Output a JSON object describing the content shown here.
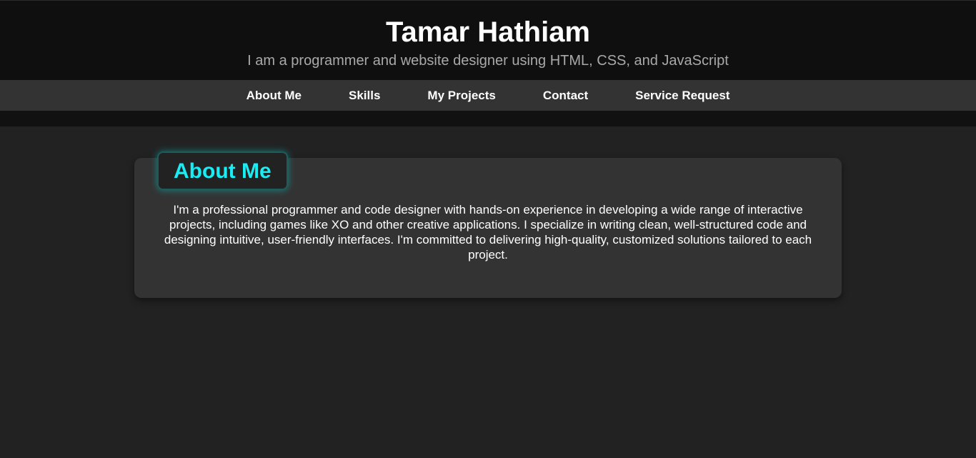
{
  "header": {
    "title": "Tamar Hathiam",
    "subtitle": "I am a programmer and website designer using HTML, CSS, and JavaScript"
  },
  "nav": {
    "items": [
      {
        "label": "About Me"
      },
      {
        "label": "Skills"
      },
      {
        "label": "My Projects"
      },
      {
        "label": "Contact"
      },
      {
        "label": "Service Request"
      }
    ]
  },
  "about": {
    "heading": "About Me",
    "text": "I'm a professional programmer and code designer with hands-on experience in developing a wide range of interactive projects, including games like XO and other creative applications. I specialize in writing clean, well-structured code and designing intuitive, user-friendly interfaces. I'm committed to delivering high-quality, customized solutions tailored to each project."
  },
  "colors": {
    "background": "#222222",
    "header_bg": "#0f0f0f",
    "nav_bg": "#333333",
    "accent": "#19ecf2",
    "card_bg": "#333333"
  }
}
